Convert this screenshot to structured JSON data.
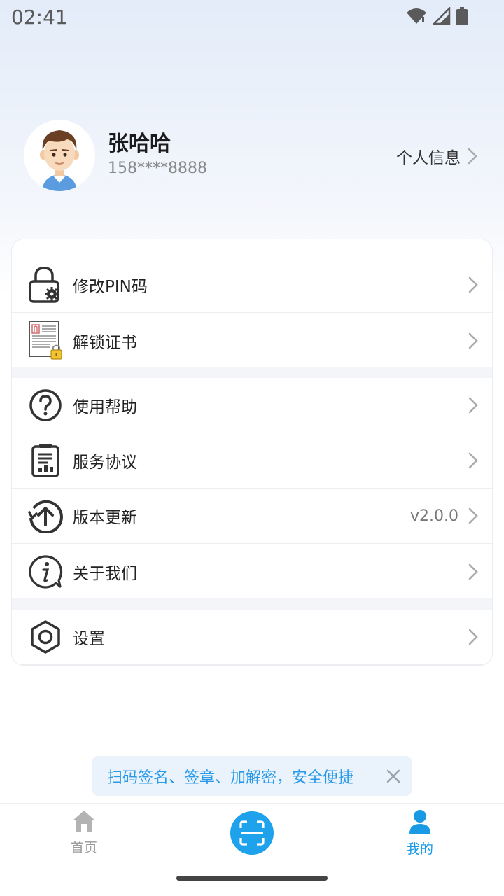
{
  "status_bar": {
    "time": "02:41"
  },
  "profile": {
    "name": "张哈哈",
    "phone": "158****8888",
    "info_link_label": "个人信息"
  },
  "menu": {
    "group1": [
      {
        "label": "修改PIN码",
        "icon": "lock-gear-icon"
      },
      {
        "label": "解锁证书",
        "icon": "certificate-lock-icon"
      }
    ],
    "group2": [
      {
        "label": "使用帮助",
        "icon": "question-circle-icon"
      },
      {
        "label": "服务协议",
        "icon": "document-chart-icon"
      },
      {
        "label": "版本更新",
        "icon": "upload-circle-icon",
        "value": "v2.0.0"
      },
      {
        "label": "关于我们",
        "icon": "info-bubble-icon"
      }
    ],
    "group3": [
      {
        "label": "设置",
        "icon": "hexagon-gear-icon"
      }
    ]
  },
  "toast": {
    "text": "扫码签名、签章、加解密，安全便捷"
  },
  "bottom_nav": {
    "home_label": "首页",
    "mine_label": "我的",
    "active": "mine"
  },
  "colors": {
    "accent": "#1ea2ec",
    "toast_text": "#2a9ae8",
    "toast_bg": "#eaf2fc",
    "header_gradient_top": "#e3ecf9"
  }
}
